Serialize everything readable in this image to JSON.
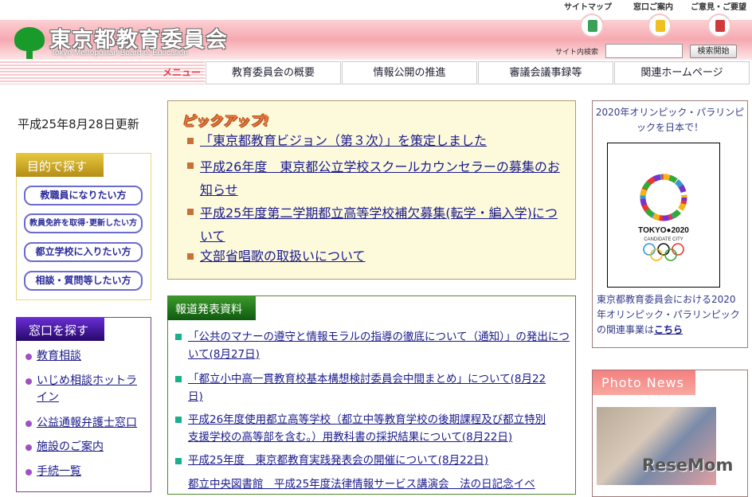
{
  "header": {
    "title": "東京都教育委員会",
    "subtitle": "Tokyo Metropolitan Board of Education",
    "top_links": [
      {
        "label": "サイトマップ",
        "icon": "document-icon"
      },
      {
        "label": "窓口ご案内",
        "icon": "person-icon"
      },
      {
        "label": "ご意見・ご要望",
        "icon": "postbox-icon"
      }
    ],
    "search_label": "サイト内検索",
    "search_value": "",
    "search_button": "検索開始"
  },
  "menu": {
    "label": "メニュー",
    "tabs": [
      "教育委員会の概要",
      "情報公開の推進",
      "審議会議事録等",
      "関連ホームページ"
    ]
  },
  "updated": "平成25年8月28日更新",
  "purpose": {
    "title": "目的で探す",
    "buttons": [
      "教職員になりたい方",
      "教員免許を取得･更新したい方",
      "都立学校に入りたい方",
      "相談・質問等したい方"
    ]
  },
  "window": {
    "title": "窓口を探す",
    "items": [
      "教育相談",
      "いじめ相談ホットライン",
      "公益通報弁護士窓口",
      "施設のご案内",
      "手続一覧"
    ]
  },
  "pickup": {
    "title": "ピックアップ!",
    "items": [
      "「東京都教育ビジョン（第３次）」を策定しました",
      "平成26年度　東京都公立学校スクールカウンセラーの募集のお知らせ",
      "平成25年度第二学期都立高等学校補欠募集(転学・編入学)について",
      "文部省唱歌の取扱いについて"
    ]
  },
  "news": {
    "title": "報道発表資料",
    "items": [
      "「公共のマナーの遵守と情報モラルの指導の徹底について（通知）」の発出について(8月27日)",
      "「都立小中高一貫教育校基本構想検討委員会中間まとめ」について(8月22日)",
      "平成26年度使用都立高等学校（都立中等教育学校の後期課程及び都立特別支援学校の高等部を含む。）用教科書の採択結果について(8月22日)",
      "平成25年度　東京都教育実践発表会の開催について(8月22日)",
      "都立中央図書館　平成25年度法律情報サービス講演会　法の日記念イベ"
    ]
  },
  "olympic": {
    "heading": "2020年オリンピック・パラリンピックを日本で！",
    "logo_text": "TOKYO●2020",
    "logo_sub": "CANDIDATE CITY",
    "text": "東京都教育委員会における2020年オリンピック・パラリンピックの関連事業は",
    "link": "こちら"
  },
  "photo": {
    "title": "Photo News",
    "watermark": "ReseMom"
  }
}
